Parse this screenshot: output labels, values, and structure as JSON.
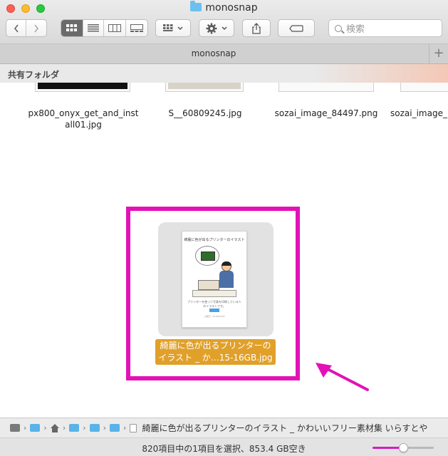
{
  "window": {
    "title": "monosnap"
  },
  "toolbar": {
    "search_placeholder": "検索"
  },
  "tab": {
    "title": "monosnap",
    "add": "+"
  },
  "sidebar_section": {
    "label": "共有フォルダ"
  },
  "files": [
    {
      "name_line1": "px800_onyx_get_and_inst",
      "name_line2": "all01.jpg"
    },
    {
      "name_line1": "S__60809245.jpg",
      "name_line2": ""
    },
    {
      "name_line1": "sozai_image_84497.png",
      "name_line2": ""
    },
    {
      "name_line1": "sozai_image_",
      "name_line2": ""
    }
  ],
  "selected": {
    "label_line1": "綺麗に色が出るプリンターの",
    "label_line2": "イラスト _ か…15-16GB.jpg",
    "doc_title": "綺麗に色が出るプリンターのイラスト",
    "doc_caption": "プリンターを使って写真を印刷している人のイラストです。",
    "doc_small": "公開日：2018/02/05"
  },
  "pathbar": {
    "filename": "綺麗に色が出るプリンターのイラスト _ かわいいフリー素材集 いらすとや"
  },
  "status": {
    "text": "820項目中の1項目を選択、853.4 GB空き"
  },
  "icon_size_slider": {
    "value": 0.5
  },
  "colors": {
    "highlight": "#e212b7",
    "selection": "#e0a02a",
    "slider_fill": "#d21fc1"
  }
}
